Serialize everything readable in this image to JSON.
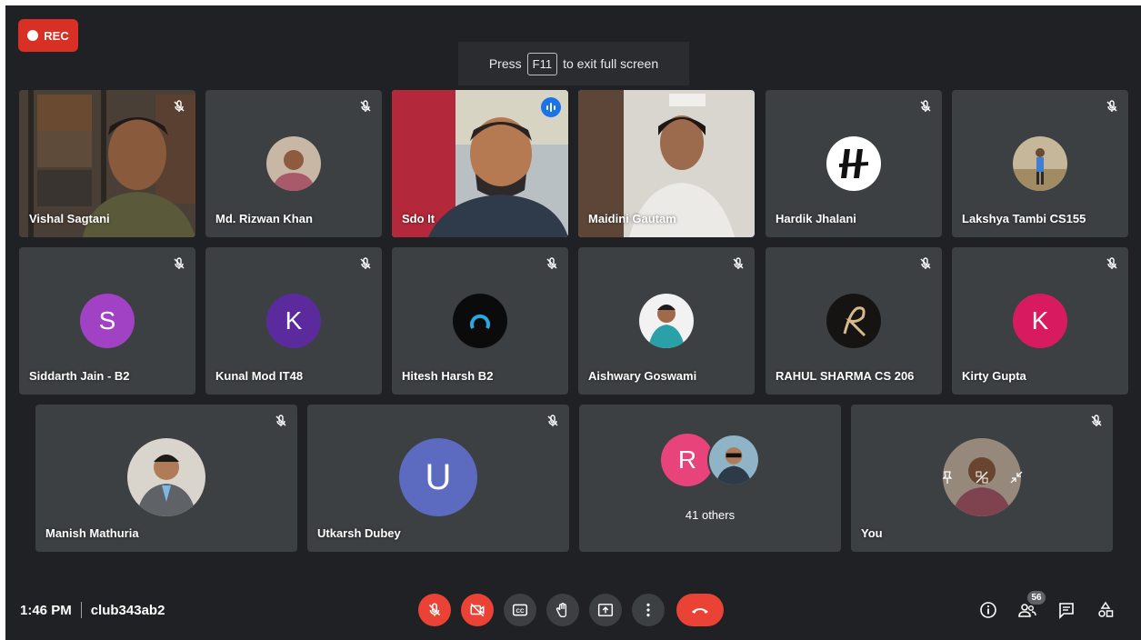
{
  "recording": {
    "label": "REC"
  },
  "fullscreen_banner": {
    "press": "Press",
    "key": "F11",
    "suffix": "to exit full screen"
  },
  "participants": {
    "vishal": {
      "name": "Vishal Sagtani"
    },
    "rizwan": {
      "name": "Md. Rizwan Khan"
    },
    "sdo": {
      "name": "Sdo It"
    },
    "maidini": {
      "name": "Maidini Gautam"
    },
    "hardik": {
      "name": "Hardik Jhalani"
    },
    "lakshya": {
      "name": "Lakshya Tambi CS155"
    },
    "siddarth": {
      "name": "Siddarth Jain - B2",
      "initial": "S",
      "color": "#a142c4"
    },
    "kunal": {
      "name": "Kunal Mod IT48",
      "initial": "K",
      "color": "#5b2b9e"
    },
    "hitesh": {
      "name": "Hitesh Harsh B2"
    },
    "aishwary": {
      "name": "Aishwary Goswami"
    },
    "rahul": {
      "name": "RAHUL SHARMA CS 206"
    },
    "kirty": {
      "name": "Kirty Gupta",
      "initial": "K",
      "color": "#d81b60"
    },
    "manish": {
      "name": "Manish Mathuria"
    },
    "utkarsh": {
      "name": "Utkarsh Dubey",
      "initial": "U",
      "color": "#5c6bc0"
    },
    "others": {
      "label": "41 others",
      "initial": "R",
      "color": "#e8437a"
    },
    "you": {
      "name": "You"
    }
  },
  "meeting": {
    "time": "1:46 PM",
    "code": "club343ab2"
  },
  "people_count": "56",
  "colors": {
    "background": "#202124",
    "tile": "#3c4043",
    "accent": "#8ab4f8",
    "danger": "#ea4335"
  }
}
